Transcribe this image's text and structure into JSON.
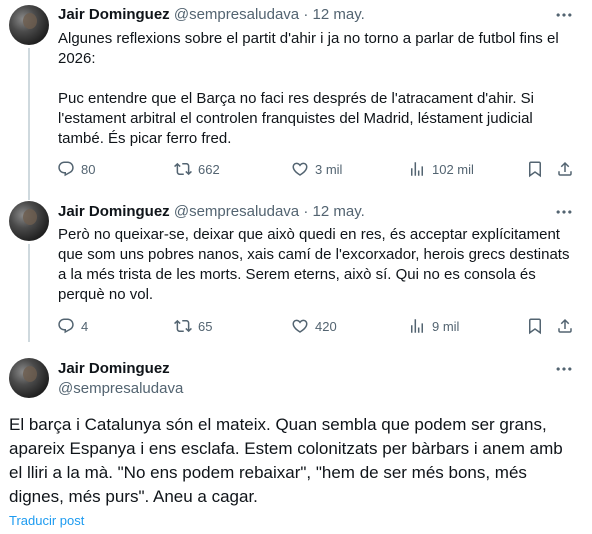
{
  "tweets": [
    {
      "name": "Jair Dominguez",
      "handle": "@sempresaludava",
      "dot": "·",
      "date": "12 may.",
      "text": "Algunes reflexions sobre el partit d'ahir i ja no torno a parlar de futbol fins el 2026:\n\nPuc entendre que el Barça no faci res després de l'atracament d'ahir. Si l'estament arbitral el controlen franquistes del Madrid, léstament judicial també. És picar ferro fred.",
      "replies": "80",
      "retweets": "662",
      "likes": "3 mil",
      "views": "102 mil"
    },
    {
      "name": "Jair Dominguez",
      "handle": "@sempresaludava",
      "dot": "·",
      "date": "12 may.",
      "text": "Però no queixar-se, deixar que això quedi en res, és acceptar explícitament que som uns pobres nanos, xais camí de l'excorxador, herois grecs destinats a la més trista de les morts. Serem eterns, això sí. Qui no es consola és perquè no vol.",
      "replies": "4",
      "retweets": "65",
      "likes": "420",
      "views": "9 mil"
    }
  ],
  "main_tweet": {
    "name": "Jair Dominguez",
    "handle": "@sempresaludava",
    "text": "El barça i Catalunya són el mateix. Quan sembla que podem ser grans, apareix Espanya i ens esclafa. Estem colonitzats per bàrbars i anem amb el lliri a la mà. \"No ens podem rebaixar\", \"hem de ser més bons, més dignes, més purs\". Aneu a cagar.",
    "translate_label": "Traducir post"
  },
  "icons": {
    "reply": "reply-icon",
    "retweet": "retweet-icon",
    "like": "heart-icon",
    "views": "views-icon",
    "bookmark": "bookmark-icon",
    "share": "share-icon",
    "more": "more-icon"
  },
  "colors": {
    "text": "#0f1419",
    "secondary": "#536471",
    "link": "#1d9bf0",
    "thread_line": "#cfd9de"
  }
}
